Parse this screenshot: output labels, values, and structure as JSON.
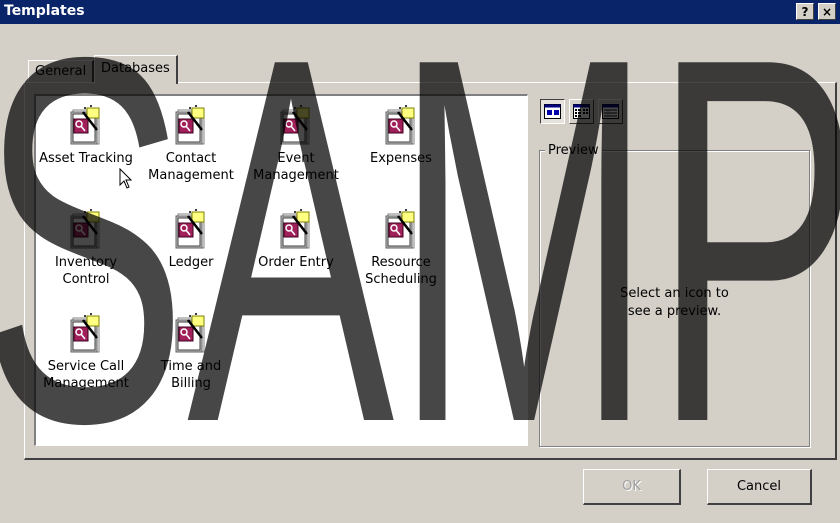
{
  "window": {
    "title": "Templates",
    "help_button": "?",
    "close_button": "×"
  },
  "tabs": [
    {
      "label": "General",
      "selected": false
    },
    {
      "label": "Databases",
      "selected": true
    }
  ],
  "templates": [
    {
      "label": "Asset Tracking"
    },
    {
      "label": "Contact\nManagement"
    },
    {
      "label": "Event\nManagement"
    },
    {
      "label": "Expenses"
    },
    {
      "label": "Inventory\nControl"
    },
    {
      "label": "Ledger"
    },
    {
      "label": "Order Entry"
    },
    {
      "label": "Resource\nScheduling"
    },
    {
      "label": "Service Call\nManagement"
    },
    {
      "label": "Time and\nBilling"
    }
  ],
  "view_buttons": [
    {
      "icon": "large-icons-view-icon",
      "active": true
    },
    {
      "icon": "list-view-icon",
      "active": false
    },
    {
      "icon": "details-view-icon",
      "active": false
    }
  ],
  "preview": {
    "legend": "Preview",
    "message": "Select an icon to\nsee a preview."
  },
  "buttons": {
    "ok": "OK",
    "cancel": "Cancel"
  },
  "watermark": {
    "text": "SAMP",
    "color": "#000000"
  }
}
